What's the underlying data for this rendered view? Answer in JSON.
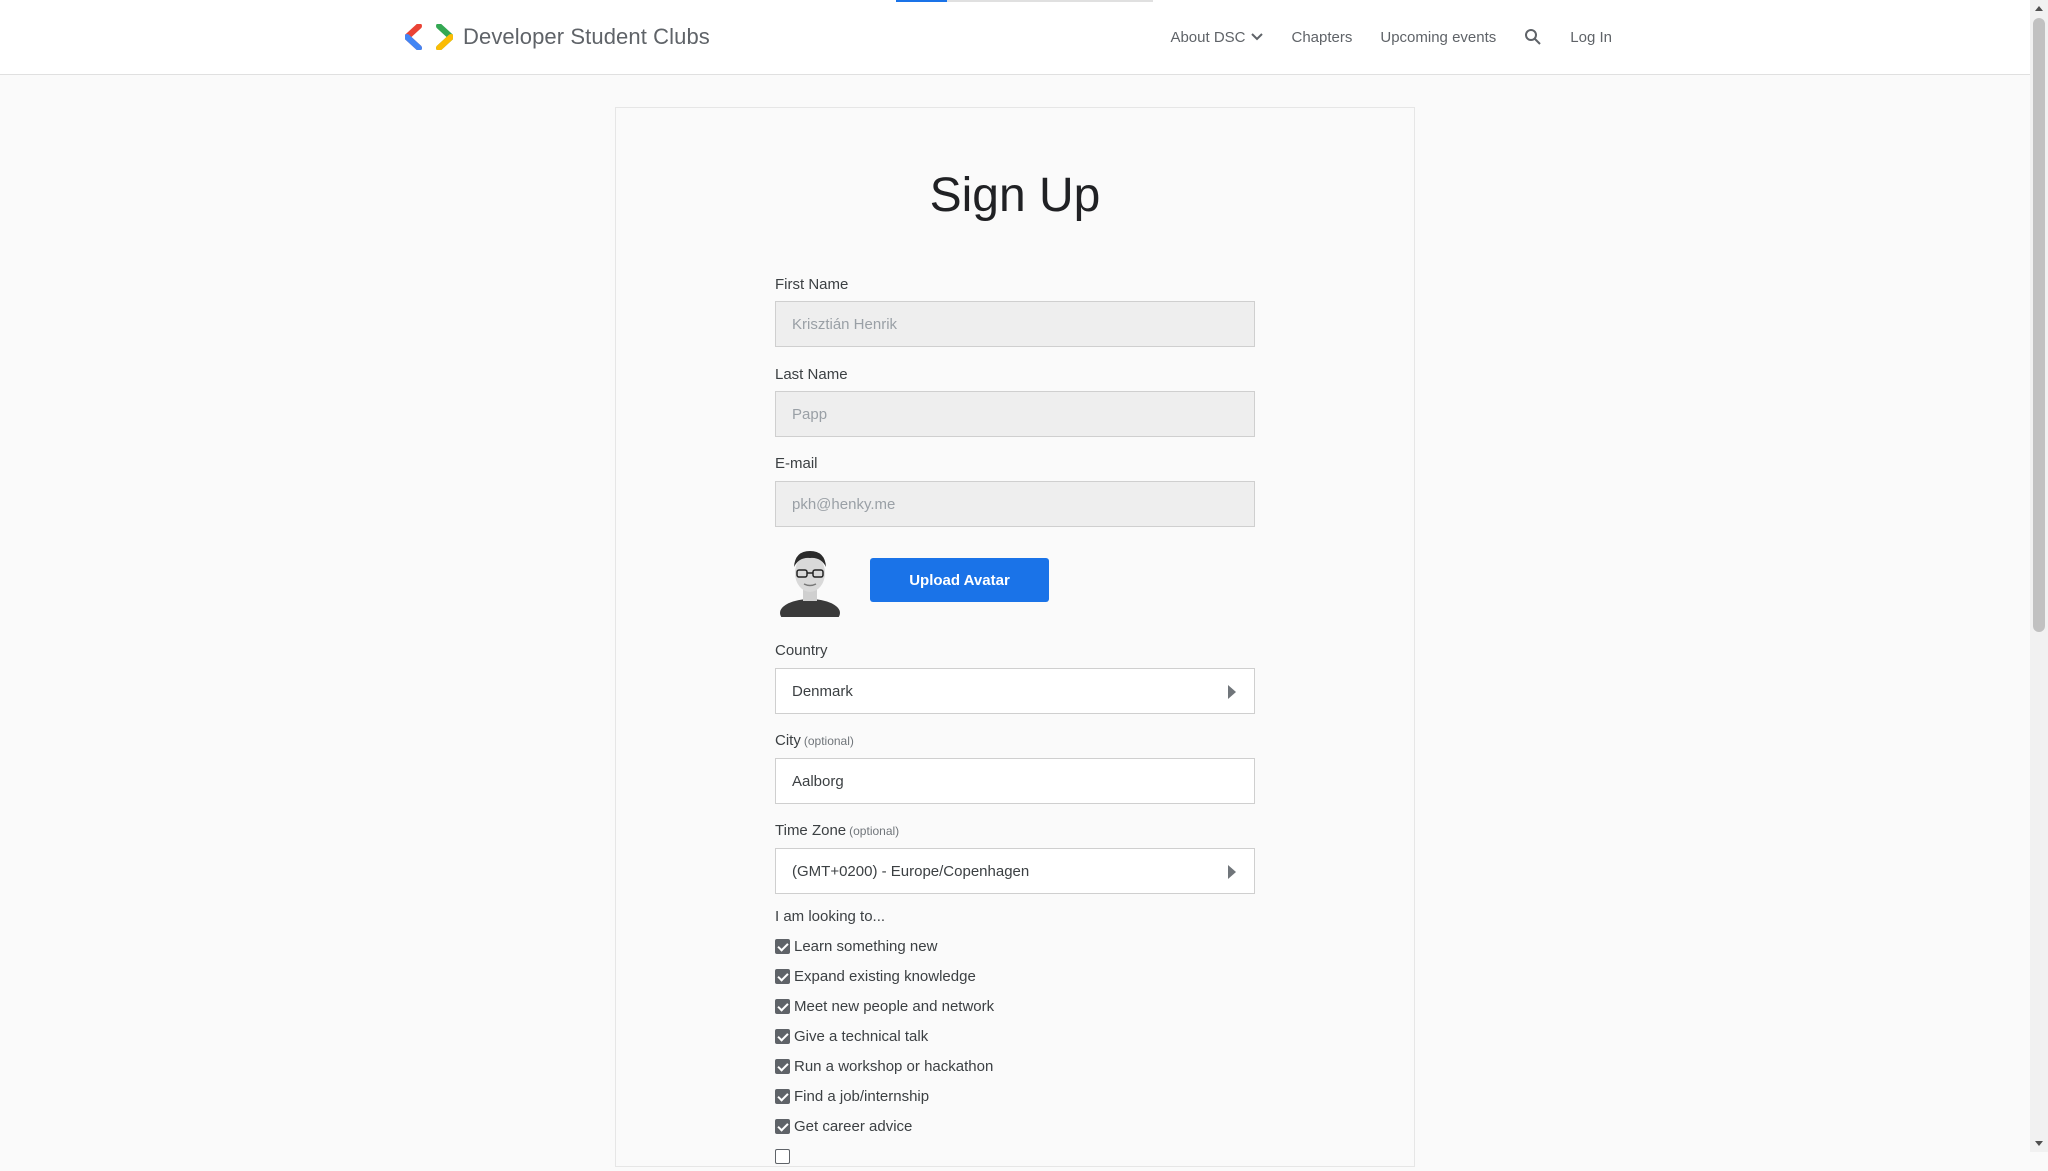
{
  "header": {
    "brand_name": "Developer Student Clubs",
    "nav": {
      "about": "About DSC",
      "chapters": "Chapters",
      "events": "Upcoming events",
      "login": "Log In"
    }
  },
  "form": {
    "title": "Sign Up",
    "first_name": {
      "label": "First Name",
      "value": "Krisztián Henrik"
    },
    "last_name": {
      "label": "Last Name",
      "value": "Papp"
    },
    "email": {
      "label": "E-mail",
      "value": "pkh@henky.me"
    },
    "upload_avatar_label": "Upload Avatar",
    "country": {
      "label": "Country",
      "value": "Denmark"
    },
    "city": {
      "label": "City",
      "optional": "(optional)",
      "value": "Aalborg"
    },
    "timezone": {
      "label": "Time Zone",
      "optional": "(optional)",
      "value": "(GMT+0200) - Europe/Copenhagen"
    },
    "looking_to": {
      "title": "I am looking to...",
      "options": [
        {
          "label": "Learn something new",
          "checked": true
        },
        {
          "label": "Expand existing knowledge",
          "checked": true
        },
        {
          "label": "Meet new people and network",
          "checked": true
        },
        {
          "label": "Give a technical talk",
          "checked": true
        },
        {
          "label": "Run a workshop or hackathon",
          "checked": true
        },
        {
          "label": "Find a job/internship",
          "checked": true
        },
        {
          "label": "Get career advice",
          "checked": true
        }
      ]
    }
  },
  "colors": {
    "accent": "#1a73e8",
    "logo_red": "#ea4335",
    "logo_blue": "#4285f4",
    "logo_green": "#34a853",
    "logo_yellow": "#fbbc04"
  }
}
